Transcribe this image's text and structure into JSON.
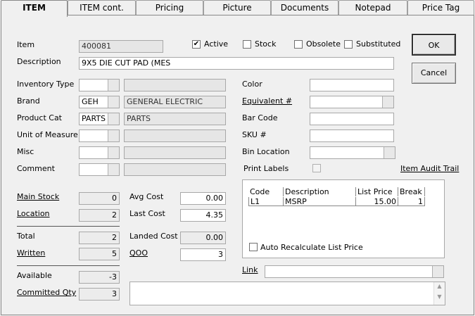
{
  "tabs": [
    {
      "label": "ITEM"
    },
    {
      "label": "ITEM cont."
    },
    {
      "label": "Pricing"
    },
    {
      "label": "Picture"
    },
    {
      "label": "Documents"
    },
    {
      "label": "Notepad"
    },
    {
      "label": "Price Tag"
    }
  ],
  "item": {
    "item_label": "Item",
    "item_value": "400081",
    "description_label": "Description",
    "description_value": "9X5 DIE CUT PAD (MES",
    "active_label": "Active",
    "stock_label": "Stock",
    "obsolete_label": "Obsolete",
    "substituted_label": "Substituted",
    "active_checked": true,
    "stock_checked": false,
    "obsolete_checked": false,
    "substituted_checked": false
  },
  "buttons": {
    "ok": "OK",
    "cancel": "Cancel"
  },
  "left_fields": {
    "inventory_type": {
      "label": "Inventory Type",
      "code": "",
      "name": ""
    },
    "brand": {
      "label": "Brand",
      "code": "GEH",
      "name": "GENERAL ELECTRIC"
    },
    "product_cat": {
      "label": "Product Cat",
      "code": "PARTS",
      "name": "PARTS"
    },
    "unit_of_measure": {
      "label": "Unit of Measure",
      "code": "",
      "name": ""
    },
    "misc": {
      "label": "Misc",
      "code": "",
      "name": ""
    },
    "comment": {
      "label": "Comment",
      "code": "",
      "name": ""
    }
  },
  "right_fields": {
    "color": {
      "label": "Color",
      "value": ""
    },
    "equivalent": {
      "label": "Equivalent #",
      "value": ""
    },
    "bar_code": {
      "label": "Bar Code",
      "value": ""
    },
    "sku": {
      "label": "SKU #",
      "value": ""
    },
    "bin_location": {
      "label": "Bin Location",
      "value": ""
    },
    "print_labels": {
      "label": "Print Labels",
      "checked": false
    },
    "audit_trail": "Item Audit Trail"
  },
  "stock": {
    "main_stock": {
      "label": "Main Stock",
      "value": "0"
    },
    "location": {
      "label": "Location",
      "value": "2"
    },
    "total": {
      "label": "Total",
      "value": "2"
    },
    "written": {
      "label": "Written",
      "value": "5"
    },
    "available": {
      "label": "Available",
      "value": "-3"
    },
    "committed": {
      "label": "Committed Qty",
      "value": "3"
    }
  },
  "costs": {
    "avg_cost": {
      "label": "Avg Cost",
      "value": "0.00"
    },
    "last_cost": {
      "label": "Last Cost",
      "value": "4.35"
    },
    "landed_cost": {
      "label": "Landed Cost",
      "value": "0.00"
    },
    "qoo": {
      "label": "QOO",
      "value": "3"
    }
  },
  "price_grid": {
    "headers": [
      "Code",
      "Description",
      "List Price",
      "Break"
    ],
    "rows": [
      {
        "code": "L1",
        "description": "MSRP",
        "list_price": "15.00",
        "break": "1"
      }
    ],
    "auto_recalc_label": "Auto Recalculate List Price",
    "auto_recalc_checked": false
  },
  "link": {
    "label": "Link",
    "value": ""
  },
  "notes": ""
}
